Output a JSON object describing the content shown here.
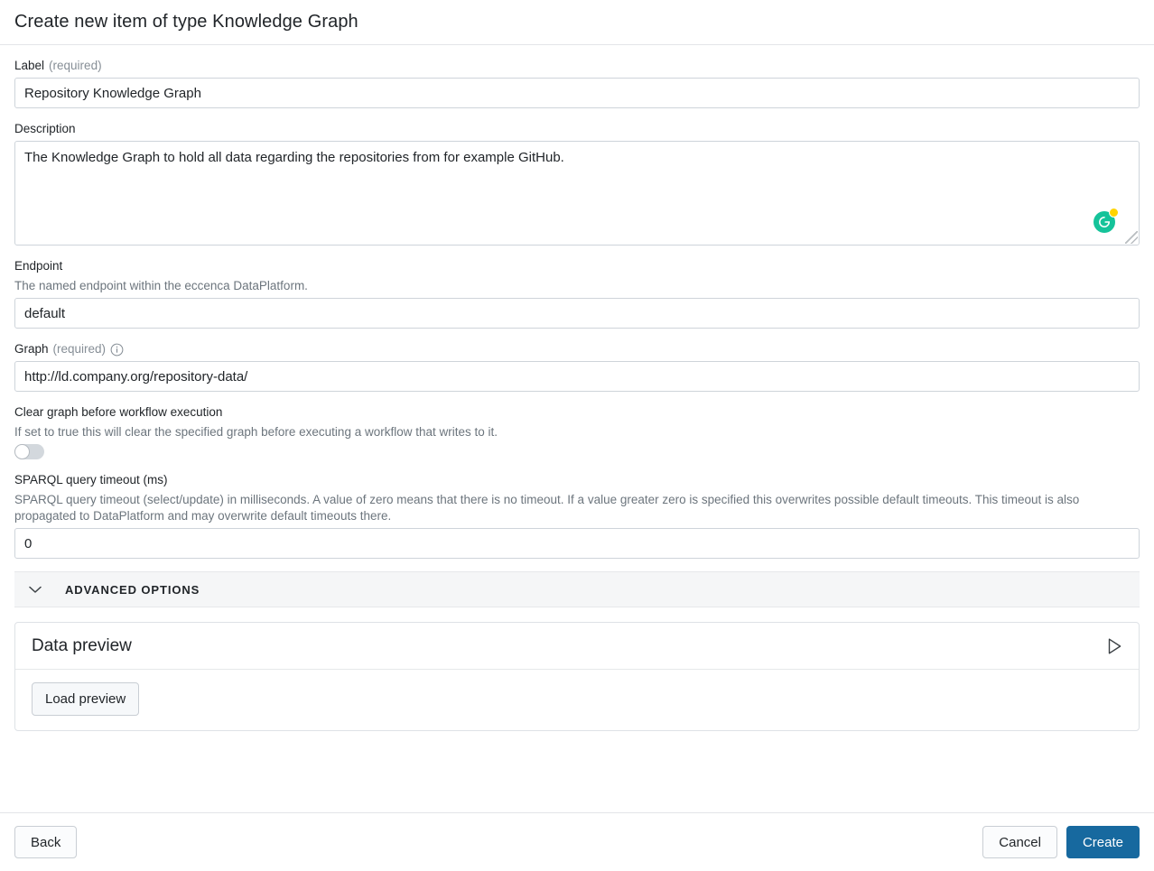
{
  "header": {
    "title": "Create new item of type Knowledge Graph"
  },
  "form": {
    "label_field": {
      "label": "Label",
      "required_text": "(required)",
      "value": "Repository Knowledge Graph",
      "placeholder": ""
    },
    "description_field": {
      "label": "Description",
      "value": "The Knowledge Graph to hold all data regarding the repositories from for example GitHub.",
      "placeholder": "",
      "assistant_icon": "grammarly-icon"
    },
    "endpoint_field": {
      "label": "Endpoint",
      "description": "The named endpoint within the eccenca DataPlatform.",
      "value": "default",
      "placeholder": ""
    },
    "graph_field": {
      "label": "Graph",
      "required_text": "(required)",
      "info_icon": "info-circle-icon",
      "value": "http://ld.company.org/repository-data/",
      "placeholder": ""
    },
    "clear_graph_field": {
      "label": "Clear graph before workflow execution",
      "description": "If set to true this will clear the specified graph before executing a workflow that writes to it.",
      "toggle_state": "off"
    },
    "timeout_field": {
      "label": "SPARQL query timeout (ms)",
      "description": "SPARQL query timeout (select/update) in milliseconds. A value of zero means that there is no timeout. If a value greater zero is specified this overwrites possible default timeouts. This timeout is also propagated to DataPlatform and may overwrite default timeouts there.",
      "value": "0",
      "placeholder": ""
    }
  },
  "advanced_options": {
    "label": "ADVANCED OPTIONS",
    "chevron_icon": "chevron-down-icon",
    "expanded": false
  },
  "data_preview": {
    "title": "Data preview",
    "run_icon": "play-outline-icon",
    "load_button_label": "Load preview"
  },
  "footer": {
    "back_label": "Back",
    "cancel_label": "Cancel",
    "create_label": "Create"
  },
  "colors": {
    "primary": "#17699f",
    "grammarly_green": "#15c39a",
    "grammarly_badge": "#ffd400",
    "border": "#ced4da",
    "muted_text": "#6c757d",
    "panel_bg": "#f5f6f7"
  }
}
